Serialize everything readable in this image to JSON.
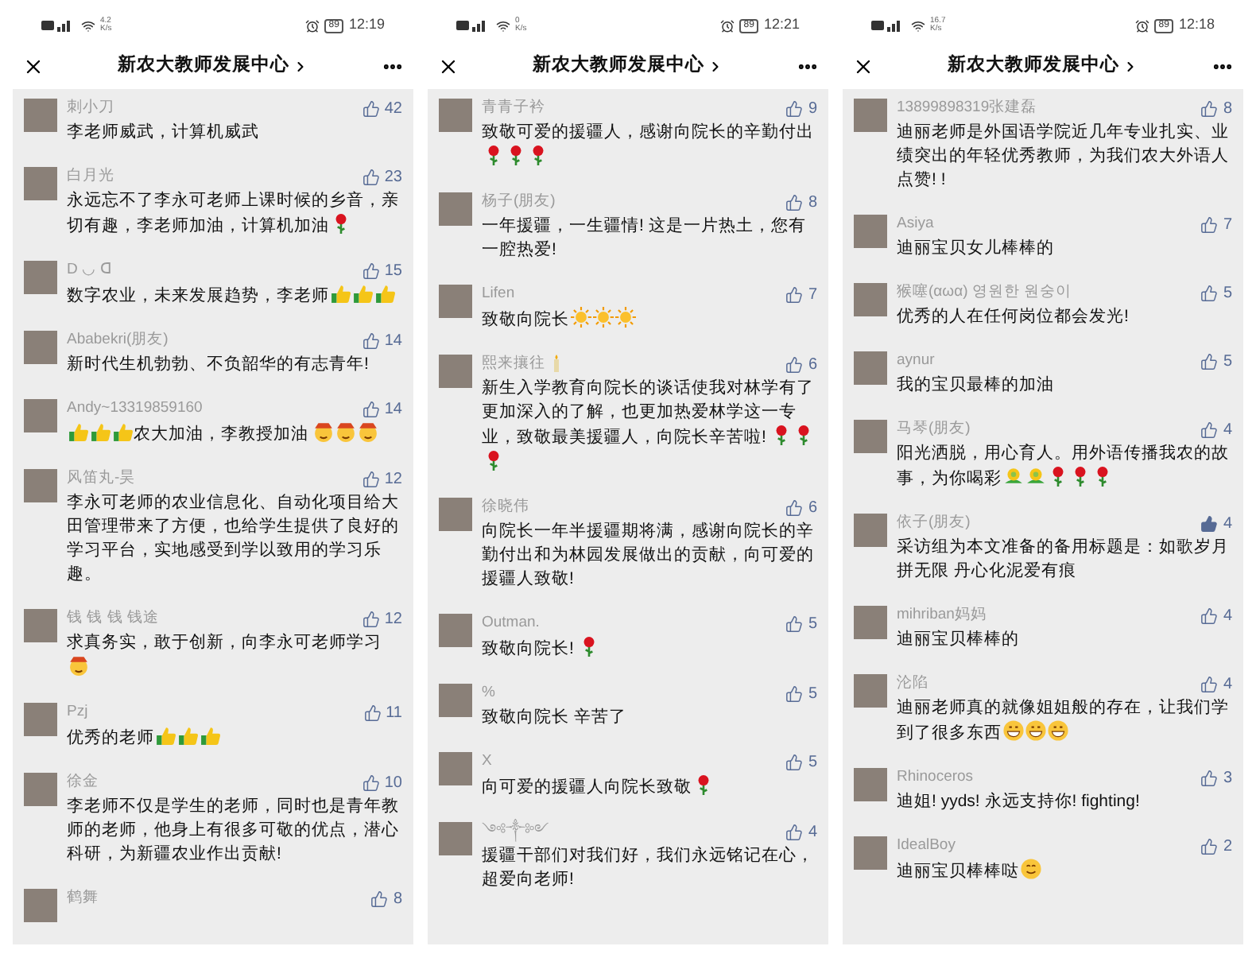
{
  "phones": [
    {
      "status": {
        "speed": "4.2",
        "speed_unit": "K/s",
        "battery": "89",
        "time": "12:19"
      },
      "title": "新农大教师发展中心",
      "comments": [
        {
          "name": "刺小刀",
          "likes": "42",
          "liked": false,
          "content": [
            "李老师威武，计算机威武"
          ]
        },
        {
          "name": "白月光",
          "likes": "23",
          "liked": false,
          "content": [
            "永远忘不了李永可老师上课时候的乡音，亲",
            {
              "kind": "break"
            },
            "切有趣，李老师加油，计算机加油",
            {
              "kind": "rose"
            }
          ]
        },
        {
          "name": "D ◡ ᗡ",
          "likes": "15",
          "liked": false,
          "content": [
            "数字农业，未来发展趋势，李老师",
            {
              "kind": "thumbs"
            },
            {
              "kind": "thumbs"
            },
            {
              "kind": "thumbs"
            }
          ]
        },
        {
          "name": "Ababekri(朋友)",
          "likes": "14",
          "liked": false,
          "content": [
            "新时代生机勃勃、不负韶华的有志青年!"
          ]
        },
        {
          "name": "Andy~13319859160",
          "likes": "14",
          "liked": false,
          "content": [
            {
              "kind": "thumbs"
            },
            {
              "kind": "thumbs"
            },
            {
              "kind": "thumbs"
            },
            "农大加油，李教授加油 ",
            {
              "kind": "hatface"
            },
            {
              "kind": "hatface"
            },
            {
              "kind": "hatface"
            }
          ]
        },
        {
          "name": "风笛丸-昊",
          "likes": "12",
          "liked": false,
          "content": [
            "李永可老师的农业信息化、自动化项目给大田管理带来了方便，也给学生提供了良好的学习平台，实地感受到学以致用的学习乐趣。"
          ]
        },
        {
          "name": "钱 钱 钱 钱途",
          "likes": "12",
          "liked": false,
          "content": [
            "求真务实，敢于创新，向李永可老师学习",
            {
              "kind": "hatface"
            }
          ]
        },
        {
          "name": "Pzj",
          "likes": "11",
          "liked": false,
          "content": [
            "优秀的老师",
            {
              "kind": "thumbs"
            },
            {
              "kind": "thumbs"
            },
            {
              "kind": "thumbs"
            }
          ]
        },
        {
          "name": "徐金",
          "likes": "10",
          "liked": false,
          "content": [
            "李老师不仅是学生的老师，同时也是青年教师的老师，他身上有很多可敬的优点，潜心科研，为新疆农业作出贡献!"
          ]
        },
        {
          "name": "鹤舞",
          "likes": "8",
          "liked": false
        }
      ]
    },
    {
      "status": {
        "speed": "0",
        "speed_unit": "K/s",
        "battery": "89",
        "time": "12:21"
      },
      "title": "新农大教师发展中心",
      "comments": [
        {
          "name": "青青子衿",
          "likes": "9",
          "liked": false,
          "content": [
            "致敬可爱的援疆人，感谢向院长的辛勤付出",
            {
              "kind": "break"
            },
            {
              "kind": "rose"
            },
            {
              "kind": "rose"
            },
            {
              "kind": "rose"
            }
          ]
        },
        {
          "name": "杨子(朋友)",
          "likes": "8",
          "liked": false,
          "content": [
            "一年援疆，一生疆情! 这是一片热土，您有一腔热爱!"
          ]
        },
        {
          "name": "Lifen",
          "likes": "7",
          "liked": false,
          "content": [
            "致敬向院长",
            {
              "kind": "sun"
            },
            {
              "kind": "sun"
            },
            {
              "kind": "sun"
            }
          ]
        },
        {
          "name": "熙来攘往",
          "name_icon": {
            "kind": "candle"
          },
          "likes": "6",
          "liked": false,
          "content": [
            "新生入学教育向院长的谈话使我对林学有了更加深入的了解，也更加热爱林学这一专",
            {
              "kind": "break"
            },
            "业，致敬最美援疆人，向院长辛苦啦! ",
            {
              "kind": "rose"
            },
            {
              "kind": "rose"
            },
            {
              "kind": "rose"
            }
          ]
        },
        {
          "name": "徐晓伟",
          "likes": "6",
          "liked": false,
          "content": [
            "向院长一年半援疆期将满，感谢向院长的辛勤付出和为林园发展做出的贡献，向可爱的援疆人致敬!"
          ]
        },
        {
          "name": "Outman.",
          "likes": "5",
          "liked": false,
          "content": [
            "致敬向院长! ",
            {
              "kind": "rose"
            }
          ]
        },
        {
          "name": "%",
          "likes": "5",
          "liked": false,
          "content": [
            "致敬向院长  辛苦了"
          ]
        },
        {
          "name": "X",
          "likes": "5",
          "liked": false,
          "content": [
            "向可爱的援疆人向院长致敬",
            {
              "kind": "rose"
            }
          ]
        },
        {
          "name": "༺༒༻",
          "likes": "4",
          "liked": false,
          "content": [
            "援疆干部们对我们好，我们永远铭记在心，超爱向老师!"
          ]
        }
      ]
    },
    {
      "status": {
        "speed": "16.7",
        "speed_unit": "K/s",
        "battery": "89",
        "time": "12:18"
      },
      "title": "新农大教师发展中心",
      "comments": [
        {
          "name": "13899898319张建磊",
          "likes": "8",
          "liked": false,
          "content": [
            "迪丽老师是外国语学院近几年专业扎实、业绩突出的年轻优秀教师，为我们农大外语人点赞! !"
          ]
        },
        {
          "name": "Asiya",
          "likes": "7",
          "liked": false,
          "content": [
            "迪丽宝贝女儿棒棒的"
          ]
        },
        {
          "name": "猴噻(αωα) 영원한 원숭이",
          "likes": "5",
          "liked": false,
          "content": [
            "优秀的人在任何岗位都会发光!"
          ]
        },
        {
          "name": "aynur",
          "likes": "5",
          "liked": false,
          "content": [
            "我的宝贝最棒的加油"
          ]
        },
        {
          "name": "马琴(朋友)",
          "likes": "4",
          "liked": false,
          "content": [
            "阳光洒脱，用心育人。用外语传播我农的故",
            {
              "kind": "break"
            },
            "事，为你喝彩",
            {
              "kind": "flower"
            },
            {
              "kind": "flower"
            },
            {
              "kind": "rose"
            },
            {
              "kind": "rose"
            },
            {
              "kind": "rose"
            }
          ]
        },
        {
          "name": "依子(朋友)",
          "likes": "4",
          "liked": true,
          "content": [
            "采访组为本文准备的备用标题是：如歌岁月拼无限 丹心化泥爱有痕"
          ]
        },
        {
          "name": "mihriban妈妈",
          "likes": "4",
          "liked": false,
          "content": [
            "迪丽宝贝棒棒的"
          ]
        },
        {
          "name": "沦陷",
          "likes": "4",
          "liked": false,
          "content": [
            "迪丽老师真的就像姐姐般的存在，让我们学",
            {
              "kind": "break"
            },
            "到了很多东西",
            {
              "kind": "grin"
            },
            {
              "kind": "grin"
            },
            {
              "kind": "grin"
            }
          ]
        },
        {
          "name": "Rhinoceros",
          "likes": "3",
          "liked": false,
          "content": [
            "迪姐! yyds! 永远支持你! fighting!"
          ]
        },
        {
          "name": "IdealBoy",
          "likes": "2",
          "liked": false,
          "content": [
            "迪丽宝贝棒棒哒",
            {
              "kind": "smile"
            }
          ]
        }
      ]
    }
  ]
}
